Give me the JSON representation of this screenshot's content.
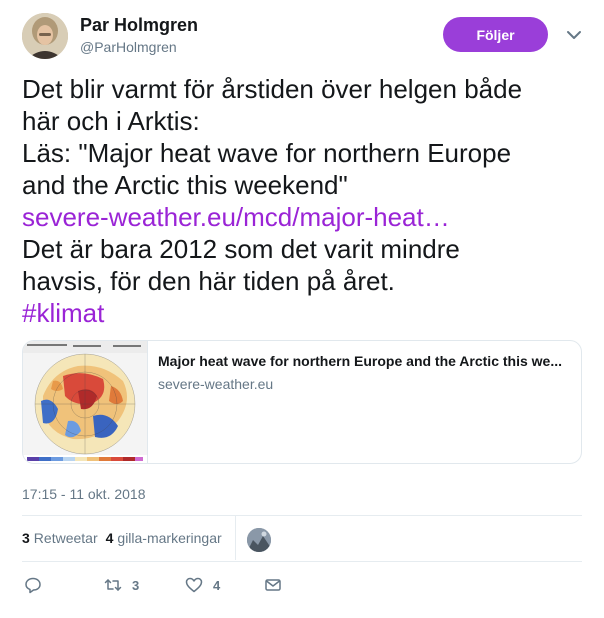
{
  "author": {
    "name": "Par Holmgren",
    "handle": "@ParHolmgren",
    "avatar_icon": "profile-photo"
  },
  "follow_button": {
    "label": "Följer",
    "color": "#9a3ed9"
  },
  "tweet": {
    "lines": [
      {
        "text": "Det blir varmt för årstiden över helgen både",
        "type": "text"
      },
      {
        "text": "här och i Arktis:",
        "type": "text"
      },
      {
        "text": "Läs: \"Major heat wave for northern Europe",
        "type": "text"
      },
      {
        "text": "and the Arctic this weekend\"",
        "type": "text"
      },
      {
        "text": "severe-weather.eu/mcd/major-heat…",
        "type": "link"
      },
      {
        "text": "Det är bara 2012 som det varit mindre",
        "type": "text"
      },
      {
        "text": "havsis, för den här tiden på året.",
        "type": "text"
      },
      {
        "text": "#klimat",
        "type": "link"
      }
    ],
    "link_color": "#9a24d6"
  },
  "card": {
    "title": "Major heat wave for northern Europe and the Arctic this we...",
    "domain": "severe-weather.eu",
    "thumb_icon": "temperature-anomaly-map"
  },
  "timestamp": "17:15 - 11 okt. 2018",
  "stats": {
    "retweets_count": "3",
    "retweets_label": "Retweetar",
    "likes_count": "4",
    "likes_label": "gilla-markeringar"
  },
  "actions": {
    "reply_icon": "reply-icon",
    "retweet_icon": "retweet-icon",
    "retweet_count": "3",
    "like_icon": "heart-icon",
    "like_count": "4",
    "dm_icon": "envelope-icon"
  }
}
